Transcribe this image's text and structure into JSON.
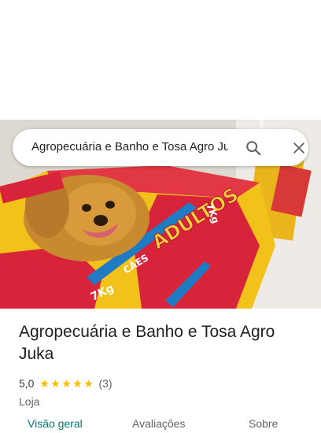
{
  "search": {
    "query": "Agropecuária e Banho e Tosa Agro Juka",
    "search_icon": "search-icon",
    "close_icon": "close-icon"
  },
  "place": {
    "title": "Agropecuária e Banho e Tosa Agro Juka",
    "rating": "5,0",
    "stars": 5,
    "review_count": "(3)",
    "category": "Loja",
    "photo_text": "CÃES ADULTOS",
    "photo_weight": "7Kg"
  },
  "tabs": [
    {
      "label": "Visão geral",
      "active": true
    },
    {
      "label": "Avaliações",
      "active": false
    },
    {
      "label": "Sobre",
      "active": false
    }
  ],
  "colors": {
    "accent": "#01796f",
    "star": "#fbbc04",
    "bag_yellow": "#f2c21a",
    "bag_red": "#d8243a"
  }
}
